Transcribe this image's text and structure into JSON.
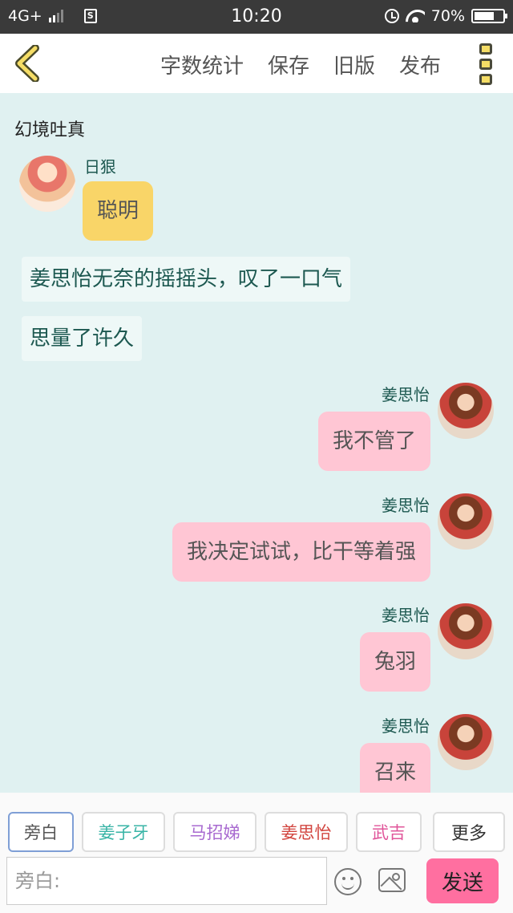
{
  "status_bar": {
    "network": "4G+",
    "time": "10:20",
    "battery": "70%",
    "battery_level": 0.7
  },
  "header": {
    "actions": [
      "字数统计",
      "保存",
      "旧版",
      "发布"
    ]
  },
  "chat": {
    "title": "幻境吐真",
    "items": [
      {
        "type": "left",
        "name": "日狠",
        "text": "聪明"
      },
      {
        "type": "narration",
        "text": "姜思怡无奈的摇摇头，叹了一口气"
      },
      {
        "type": "narration",
        "text": "思量了许久"
      },
      {
        "type": "right",
        "name": "姜思怡",
        "text": "我不管了"
      },
      {
        "type": "right",
        "name": "姜思怡",
        "text": "我决定试试，比干等着强"
      },
      {
        "type": "right",
        "name": "姜思怡",
        "text": "兔羽"
      },
      {
        "type": "right",
        "name": "姜思怡",
        "text": "召来"
      }
    ]
  },
  "roles": [
    {
      "label": "旁白",
      "color": "#555555",
      "active": true
    },
    {
      "label": "姜子牙",
      "color": "#39b4a6",
      "active": false
    },
    {
      "label": "马招娣",
      "color": "#a86ad0",
      "active": false
    },
    {
      "label": "姜思怡",
      "color": "#d2453f",
      "active": false
    },
    {
      "label": "武吉",
      "color": "#e0559a",
      "active": false
    }
  ],
  "roles_more": "更多",
  "input": {
    "placeholder": "旁白:",
    "value": ""
  },
  "send_label": "发送",
  "colors": {
    "bubble_left": "#f9d568",
    "bubble_right": "#ffc6d4",
    "chat_bg": "#e0f1f1",
    "send": "#ff6fa0"
  }
}
